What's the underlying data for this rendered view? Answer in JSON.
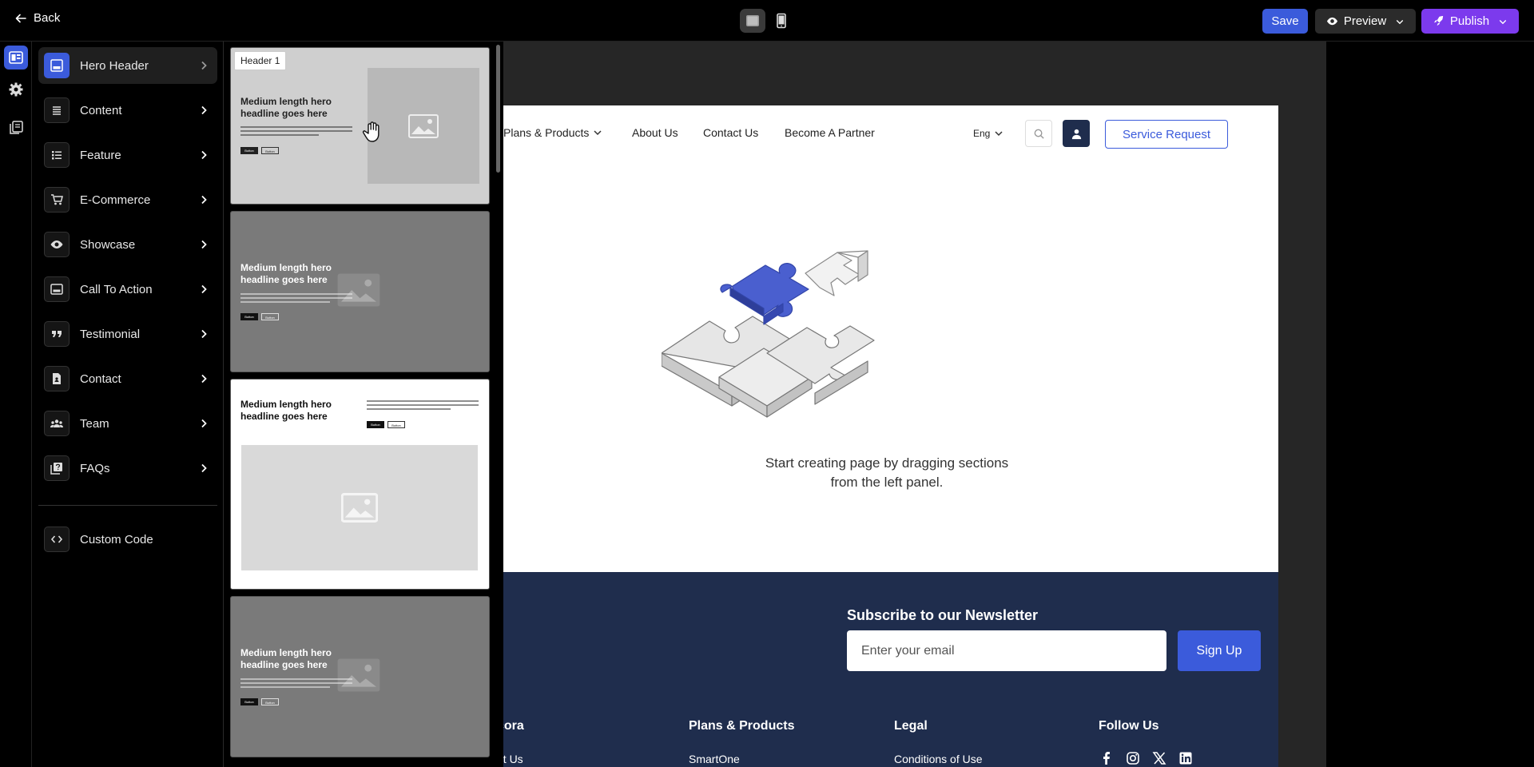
{
  "topbar": {
    "back_label": "Back",
    "save_label": "Save",
    "preview_label": "Preview",
    "publish_label": "Publish"
  },
  "categories": [
    {
      "label": "Hero Header",
      "icon": "hero-header-icon"
    },
    {
      "label": "Content",
      "icon": "content-icon"
    },
    {
      "label": "Feature",
      "icon": "feature-icon"
    },
    {
      "label": "E-Commerce",
      "icon": "cart-icon"
    },
    {
      "label": "Showcase",
      "icon": "eye-icon"
    },
    {
      "label": "Call To Action",
      "icon": "cta-icon"
    },
    {
      "label": "Testimonial",
      "icon": "quote-icon"
    },
    {
      "label": "Contact",
      "icon": "contact-icon"
    },
    {
      "label": "Team",
      "icon": "team-icon"
    },
    {
      "label": "FAQs",
      "icon": "faq-icon"
    }
  ],
  "custom_code_label": "Custom Code",
  "thumbnails": {
    "tag": "Header 1",
    "headline": "Medium length hero headline goes here",
    "btn_primary": "Button",
    "btn_secondary": "Button"
  },
  "site": {
    "nav": [
      "Plans & Products",
      "About Us",
      "Contact Us",
      "Become A Partner"
    ],
    "lang": "Eng",
    "service_button": "Service Request",
    "empty_message_line1": "Start creating page by dragging sections",
    "empty_message_line2": "from the left panel."
  },
  "footer": {
    "newsletter_title": "Subscribe to our Newsletter",
    "email_placeholder": "Enter your email",
    "signup_label": "Sign Up",
    "col1_title": "cora",
    "col1_link": "ut Us",
    "col2_title": "Plans & Products",
    "col2_link": "SmartOne",
    "col3_title": "Legal",
    "col3_link": "Conditions of Use",
    "col4_title": "Follow Us"
  },
  "colors": {
    "accent_blue": "#3b5bdb",
    "publish_purple": "#7c3aed",
    "footer_navy": "#1f2d4d"
  }
}
